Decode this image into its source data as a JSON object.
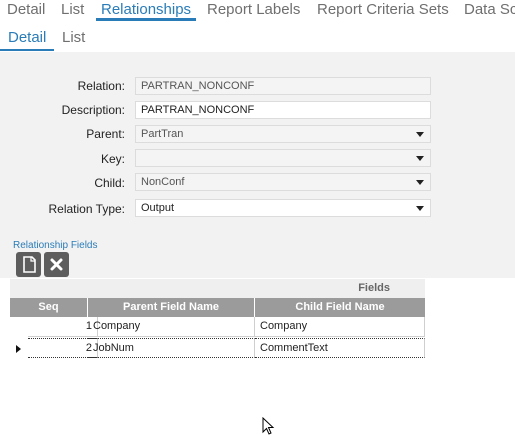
{
  "top_tabs": [
    "Detail",
    "List",
    "Relationships",
    "Report Labels",
    "Report Criteria Sets",
    "Data Sc"
  ],
  "sub_tabs": [
    "Detail",
    "List"
  ],
  "form": {
    "relation_label": "Relation:",
    "relation_value": "PARTRAN_NONCONF",
    "description_label": "Description:",
    "description_value": "PARTRAN_NONCONF",
    "parent_label": "Parent:",
    "parent_value": "PartTran",
    "key_label": "Key:",
    "key_value": "",
    "child_label": "Child:",
    "child_value": "NonConf",
    "relation_type_label": "Relation Type:",
    "relation_type_value": "Output"
  },
  "section": {
    "title": "Relationship Fields",
    "new_icon": "new-document-icon",
    "delete_icon": "delete-x-icon"
  },
  "grid": {
    "group_header": "Fields",
    "columns": [
      "Seq",
      "Parent Field Name",
      "Child Field Name"
    ],
    "rows": [
      {
        "seq": "1",
        "parent": "Company",
        "child": "Company"
      },
      {
        "seq": "2",
        "parent": "JobNum",
        "child": "CommentText"
      }
    ]
  },
  "colors": {
    "accent": "#2a7cb8",
    "panel_bg": "#f2f2f2",
    "header_bg": "#9b9b9b",
    "button_bg": "#5d5d5d"
  }
}
